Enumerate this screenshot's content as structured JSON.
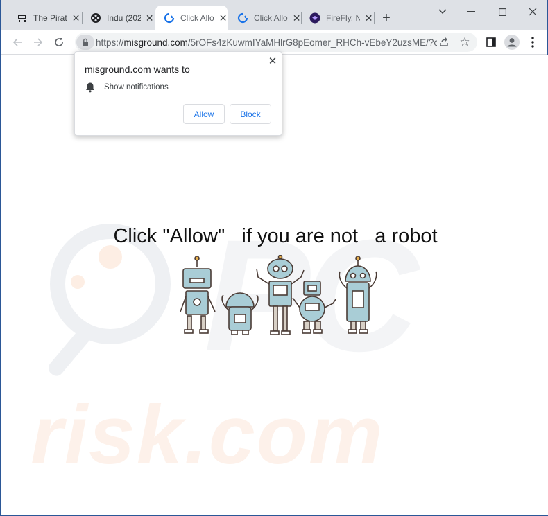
{
  "tabs": [
    {
      "title": "The Pirat",
      "icon": "pirate-ship-icon",
      "active": false
    },
    {
      "title": "Indu (202",
      "icon": "film-reel-icon",
      "active": false
    },
    {
      "title": "Click Allo",
      "icon": "loading-spinner-icon",
      "active": true
    },
    {
      "title": "Click Allo",
      "icon": "loading-spinner-icon",
      "active": false
    },
    {
      "title": "FireFly. N",
      "icon": "firefly-icon",
      "active": false
    }
  ],
  "address_bar": {
    "scheme": "https://",
    "host": "misground.com",
    "path": "/5rOFs4zKuwmIYaMHlrG8pEomer_RHCh-vEbeY2uzsME/?cid..."
  },
  "permission_prompt": {
    "title": "misground.com wants to",
    "permission": "Show notifications",
    "allow_label": "Allow",
    "block_label": "Block"
  },
  "page": {
    "headline": "Click \"Allow\"   if you are not   a robot"
  },
  "colors": {
    "tab_strip": "#dee1e6",
    "window_border": "#2b5797",
    "button_text": "#1a73e8"
  }
}
